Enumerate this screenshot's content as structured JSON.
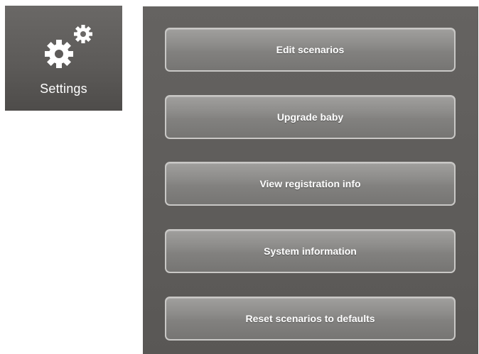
{
  "settings_tile": {
    "label": "Settings",
    "icon": "gear-icon"
  },
  "menu": {
    "buttons": [
      {
        "label": "Edit scenarios"
      },
      {
        "label": "Upgrade baby"
      },
      {
        "label": "View registration info"
      },
      {
        "label": "System information"
      },
      {
        "label": "Reset scenarios to defaults"
      }
    ]
  }
}
